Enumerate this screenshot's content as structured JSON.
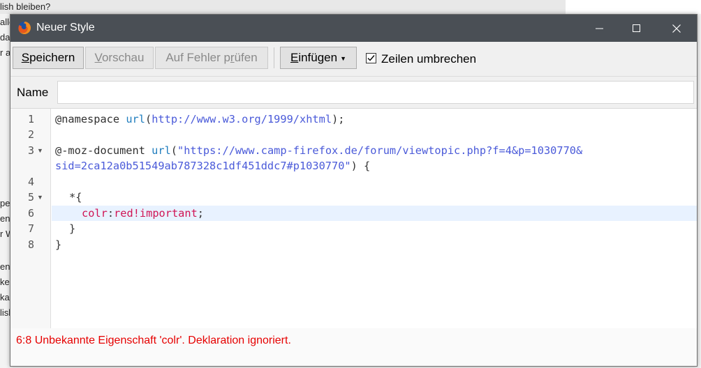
{
  "background": {
    "fragments": [
      "lish bleiben?",
      "alle",
      "da",
      "r a",
      "pe",
      "en",
      "r W",
      "en",
      "ke",
      "ka",
      "lish"
    ]
  },
  "window": {
    "title": "Neuer Style",
    "controls": {
      "minimize": "minimize",
      "maximize": "maximize",
      "close": "close"
    }
  },
  "toolbar": {
    "save_label": "Speichern",
    "preview_label": "Vorschau",
    "check_label": "Auf Fehler prüfen",
    "insert_label": "Einfügen",
    "wrap_label": "Zeilen umbrechen",
    "wrap_checked": true
  },
  "name_field": {
    "label": "Name",
    "value": ""
  },
  "editor": {
    "line_numbers": [
      "1",
      "2",
      "3",
      "",
      "4",
      "5",
      "6",
      "7",
      "8"
    ],
    "active_line": 6,
    "lines": {
      "l1": {
        "at": "@namespace",
        "fn": "url",
        "open": "(",
        "arg": "http://www.w3.org/1999/xhtml",
        "close": ");"
      },
      "l3": {
        "at": "@-moz-document",
        "fn": "url",
        "open": "(",
        "arg1": "\"https://www.camp-firefox.de/forum/viewtopic.php?f=4&p=1030770&",
        "arg2": "sid=2ca12a0b51549ab787328c1df451ddc7#p1030770\"",
        "close": ") {"
      },
      "l5": "*{",
      "l6": {
        "prop": "colr",
        "colon": ":",
        "value": "red!important",
        "semi": ";"
      },
      "l7": "}",
      "l8": "}"
    }
  },
  "status": {
    "error": "6:8 Unbekannte Eigenschaft 'colr'. Deklaration ignoriert."
  },
  "colors": {
    "titlebar": "#4a4f55",
    "error": "#e60000",
    "active_line": "#e8f2ff"
  }
}
